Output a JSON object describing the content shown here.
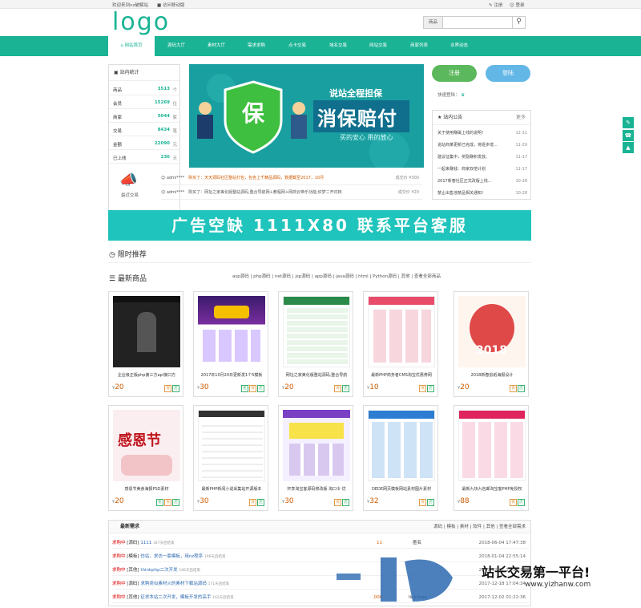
{
  "topbar": {
    "welcome": "欢迎来到nz破解站",
    "mobile": "访问移动版",
    "register": "注册",
    "login": "登录"
  },
  "logo": "logo",
  "search": {
    "select": "商品",
    "placeholder": ""
  },
  "nav": [
    "网站首页",
    "源码大厅",
    "素材大厅",
    "需求求购",
    "点卡交易",
    "域名交易",
    "网站交易",
    "商家列表",
    "业界动态"
  ],
  "stats": {
    "title": "站内统计",
    "rows": [
      {
        "k": "商品",
        "v": "3513",
        "u": "个"
      },
      {
        "k": "会员",
        "v": "15269",
        "u": "位"
      },
      {
        "k": "商家",
        "v": "5044",
        "u": "家"
      },
      {
        "k": "交易",
        "v": "8434",
        "u": "笔"
      },
      {
        "k": "金额",
        "v": "22090",
        "u": "元"
      },
      {
        "k": "已上线",
        "v": "236",
        "u": "天"
      }
    ]
  },
  "banner": {
    "shield": "保",
    "line1": "说站全程担保",
    "line2": "消保赔付",
    "line3": "买的安心 用的放心"
  },
  "buttons": {
    "register": "注册",
    "login": "登陆"
  },
  "quick_login": "快速登陆：",
  "notice": {
    "title": "站内公告",
    "more": "更多",
    "items": [
      {
        "t": "关于使用赚磁上线的说明！",
        "d": "12-11"
      },
      {
        "t": "说站商革更新已完成，将逐步增...",
        "d": "11-29"
      },
      {
        "t": "建议征集中，奖励赚积发放。",
        "d": "11-17"
      },
      {
        "t": "一起来赚钱：商家双倍计划",
        "d": "11-17"
      },
      {
        "t": "2017新春社区正式改版上线...",
        "d": "10-28"
      },
      {
        "t": "禁止出售违禁品相关通知！",
        "d": "10-28"
      }
    ]
  },
  "recent": {
    "label": "最近交易",
    "rows": [
      {
        "u": "admi****",
        "t": "购买了：天天源码社区整站打包，包含上千精品源码，数据截至2017，10月",
        "a": "成交价 ¥300"
      },
      {
        "u": "admi****",
        "t": "购买了：网址之家美化版整站源码,整合导航网+教程网+网商云帝乐功能,织梦二开内核",
        "a": "成交价 ¥20"
      }
    ]
  },
  "ad": "广告空缺  1111X80  联系平台客服",
  "limited": "限时推荐",
  "latest": {
    "title": "最新商品",
    "cats": [
      "asp源码",
      "php源码",
      "net源码",
      "jsp源码",
      "app源码",
      "java源码",
      "html",
      "Python源码",
      "其他",
      "查看全部商品"
    ]
  },
  "products": [
    {
      "name": "企业级正版php第三方api接口方",
      "price": "20"
    },
    {
      "name": "2017年10月20日更新发1个5模板",
      "price": "30"
    },
    {
      "name": "网址之家美化版整站源码,整合导航",
      "price": "20"
    },
    {
      "name": "最新PHP商务者CMS淘宝优惠券网",
      "price": "10"
    },
    {
      "name": "2018新春剪纸海报设计",
      "price": "20"
    },
    {
      "name": "感恩节美食海报PSD素材",
      "price": "20"
    },
    {
      "name": "最新PHP新闻小说采集站开源版本",
      "price": "30"
    },
    {
      "name": "轩李淘宝客源码修改版 淘口令 优",
      "price": "30"
    },
    {
      "name": "DEDE网页模板网站素材图片素材",
      "price": "32"
    },
    {
      "name": "最新九块九包邮淘宝客PHP免授权",
      "price": "88"
    }
  ],
  "currency": "¥",
  "tags": [
    "抢",
    "保",
    "店"
  ],
  "requests": {
    "title": "最新需求",
    "cats": [
      "源码",
      "模板",
      "素材",
      "软件",
      "其他",
      "查看全部需求"
    ],
    "rows": [
      {
        "tag": "求购中",
        "type": "[源码]",
        "t": "1111",
        "s": "347天后结束",
        "p": "11",
        "u": "匿名",
        "d": "2018-06-04 17:47:38"
      },
      {
        "tag": "求购中",
        "type": "[模板]",
        "t": "仿站，求仿一套模板，用nz程序",
        "s": "196天后结束",
        "p": "",
        "u": "",
        "d": "2018-01-04 22:55:14"
      },
      {
        "tag": "求购中",
        "type": "[其他]",
        "t": "thinkphp二次开发",
        "s": "186天后结束",
        "p": "",
        "u": "",
        "d": "2017-12-31 12:17:13"
      },
      {
        "tag": "求购中",
        "type": "[源码]",
        "t": "求购类似素材火的素材下载站源码",
        "s": "171天后结束",
        "p": "",
        "u": "",
        "d": "2017-12-18 17:04:34"
      },
      {
        "tag": "求购中",
        "type": "[其他]",
        "t": "征求本站二次开发，模板开发的高手",
        "s": "162天后结束",
        "p": ".000",
        "u": "linychao",
        "d": "2017-12-02 01:22:36"
      }
    ]
  },
  "watermark": {
    "brand": "站长交易第一平台!",
    "url": "www.yizhanw.com"
  }
}
